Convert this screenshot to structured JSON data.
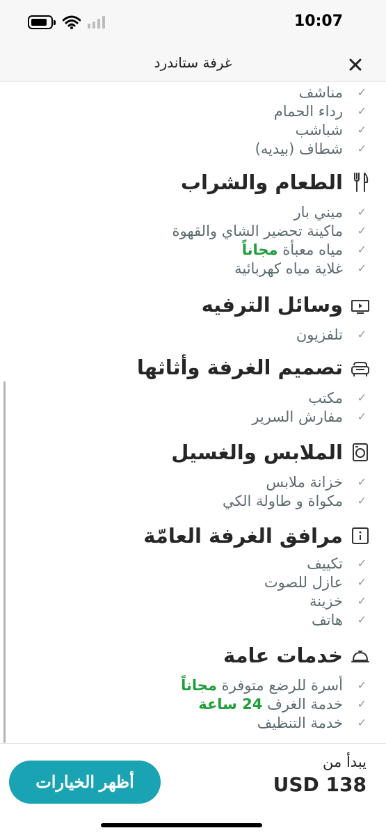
{
  "status_bar": {
    "time": "10:07"
  },
  "header": {
    "title": "غرفة ستاندرد"
  },
  "sections": {
    "bathroom": {
      "items": [
        "مناشف",
        "رداء الحمام",
        "شباشب",
        "شطاف (بيديه)"
      ]
    },
    "food": {
      "title": "الطعام والشراب",
      "items": [
        "ميني بار",
        "ماكينة تحضير الشاي والقهوة",
        "مياه معبأة",
        "غلاية مياه كهربائية"
      ],
      "free_label": "مجاناً"
    },
    "entertainment": {
      "title": "وسائل الترفيه",
      "items": [
        "تلفزيون"
      ]
    },
    "furniture": {
      "title": "تصميم الغرفة وأثاثها",
      "items": [
        "مكتب",
        "مفارش السرير"
      ]
    },
    "laundry": {
      "title": "الملابس والغسيل",
      "items": [
        "خزانة ملابس",
        "مكواة و طاولة الكي"
      ]
    },
    "general": {
      "title": "مرافق الغرفة العامّة",
      "items": [
        "تكييف",
        "عازل للصوت",
        "خزينة",
        "هاتف"
      ]
    },
    "services": {
      "title": "خدمات عامة",
      "items": [
        "أسرة للرضع متوفرة",
        "خدمة الغرف",
        "خدمة التنظيف"
      ],
      "free_label": "مجاناً",
      "room_service_hours": "24 ساعة"
    }
  },
  "footer": {
    "price_label": "يبدأ من",
    "price_value": "USD 138",
    "options_button": "أظهر الخيارات"
  },
  "colors": {
    "accent": "#1aa3b3",
    "free_text": "#1e9e3a",
    "item_text": "#5c6b70"
  },
  "icons": [
    "battery-icon",
    "wifi-icon",
    "signal-icon",
    "close-icon",
    "fork-knife-icon",
    "tv-icon",
    "sofa-icon",
    "washing-machine-icon",
    "info-icon",
    "bell-icon",
    "check-icon"
  ]
}
